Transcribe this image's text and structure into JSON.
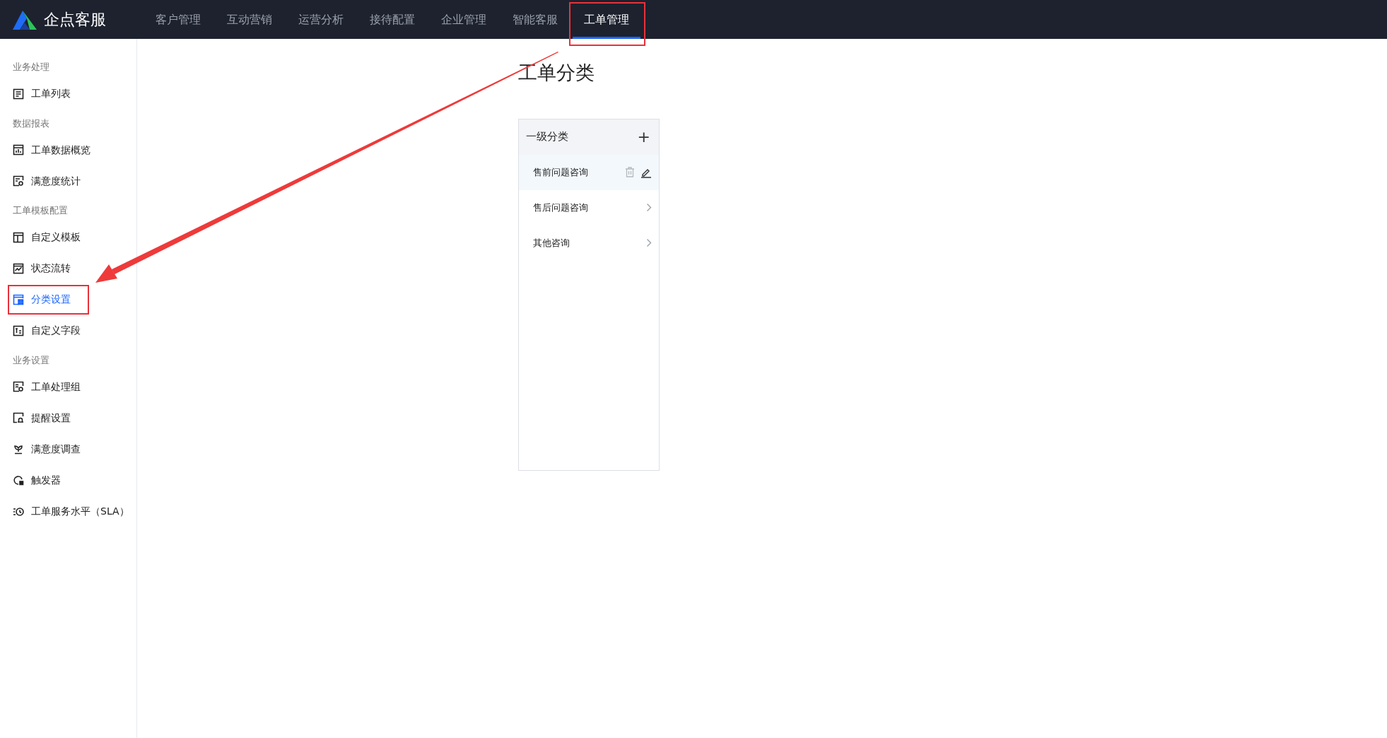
{
  "brand": {
    "name": "企点客服"
  },
  "top_nav": [
    {
      "label": "客户管理",
      "selected": false
    },
    {
      "label": "互动营销",
      "selected": false
    },
    {
      "label": "运营分析",
      "selected": false
    },
    {
      "label": "接待配置",
      "selected": false
    },
    {
      "label": "企业管理",
      "selected": false
    },
    {
      "label": "智能客服",
      "selected": false
    },
    {
      "label": "工单管理",
      "selected": true
    }
  ],
  "sidebar": {
    "groups": [
      {
        "title": "业务处理",
        "items": [
          {
            "label": "工单列表",
            "selected": false
          }
        ]
      },
      {
        "title": "数据报表",
        "items": [
          {
            "label": "工单数据概览",
            "selected": false
          },
          {
            "label": "满意度统计",
            "selected": false
          }
        ]
      },
      {
        "title": "工单模板配置",
        "items": [
          {
            "label": "自定义模板",
            "selected": false
          },
          {
            "label": "状态流转",
            "selected": false
          },
          {
            "label": "分类设置",
            "selected": true
          },
          {
            "label": "自定义字段",
            "selected": false
          }
        ]
      },
      {
        "title": "业务设置",
        "items": [
          {
            "label": "工单处理组",
            "selected": false
          },
          {
            "label": "提醒设置",
            "selected": false
          },
          {
            "label": "满意度调查",
            "selected": false
          },
          {
            "label": "触发器",
            "selected": false
          },
          {
            "label": "工单服务水平（SLA）",
            "selected": false
          }
        ]
      }
    ]
  },
  "page_title": "工单分类",
  "category_panel": {
    "title": "一级分类",
    "add_symbol": "+",
    "items": [
      {
        "label": "售前问题咨询",
        "selected": true
      },
      {
        "label": "售后问题咨询",
        "selected": false
      },
      {
        "label": "其他咨询",
        "selected": false
      }
    ]
  }
}
